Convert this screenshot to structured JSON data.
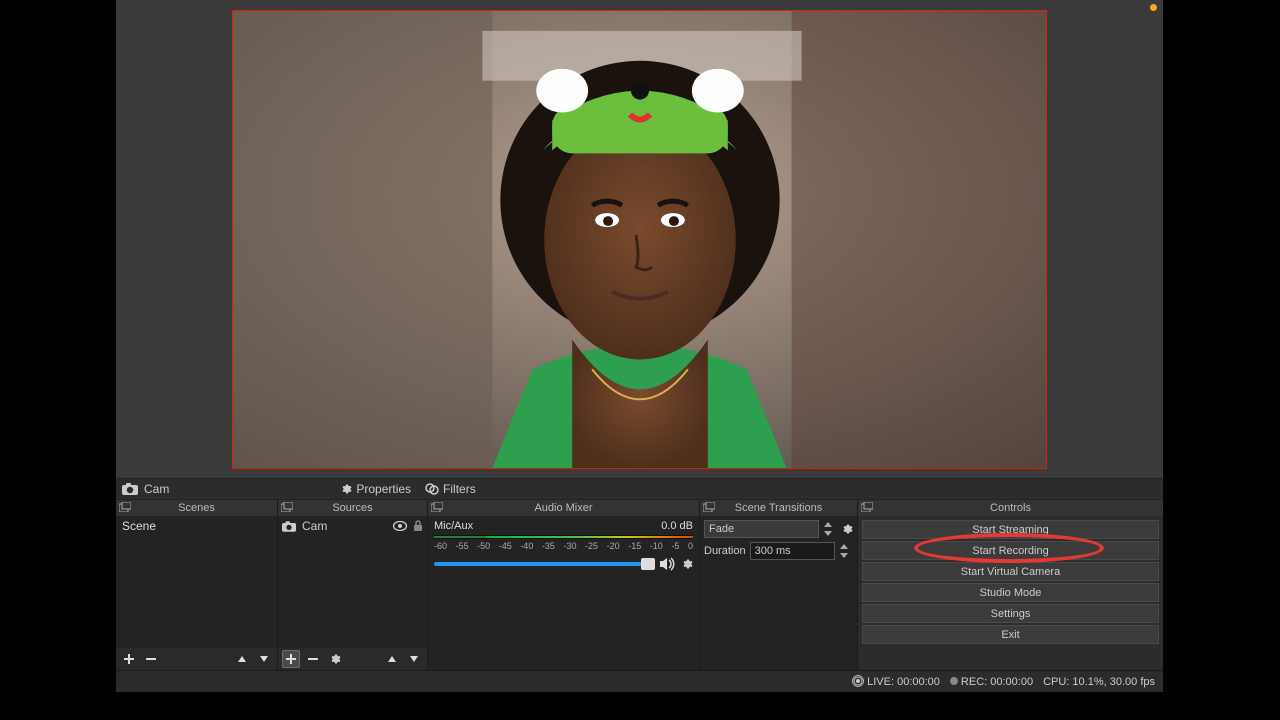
{
  "toolbar": {
    "source_label": "Cam",
    "properties": "Properties",
    "filters": "Filters"
  },
  "panels": {
    "scenes": "Scenes",
    "sources": "Sources",
    "mixer": "Audio Mixer",
    "transitions": "Scene Transitions",
    "controls": "Controls"
  },
  "scenes": {
    "items": [
      "Scene"
    ]
  },
  "sources": {
    "items": [
      {
        "name": "Cam"
      }
    ]
  },
  "mixer": {
    "channel": "Mic/Aux",
    "level": "0.0 dB",
    "ticks": [
      "-60",
      "-55",
      "-50",
      "-45",
      "-40",
      "-35",
      "-30",
      "-25",
      "-20",
      "-15",
      "-10",
      "-5",
      "0"
    ]
  },
  "transitions": {
    "type": "Fade",
    "duration_label": "Duration",
    "duration_value": "300 ms"
  },
  "controls": {
    "buttons": [
      "Start Streaming",
      "Start Recording",
      "Start Virtual Camera",
      "Studio Mode",
      "Settings",
      "Exit"
    ]
  },
  "status": {
    "live_label": "LIVE:",
    "live_time": "00:00:00",
    "rec_label": "REC:",
    "rec_time": "00:00:00",
    "cpu": "CPU: 10.1%, 30.00 fps"
  }
}
